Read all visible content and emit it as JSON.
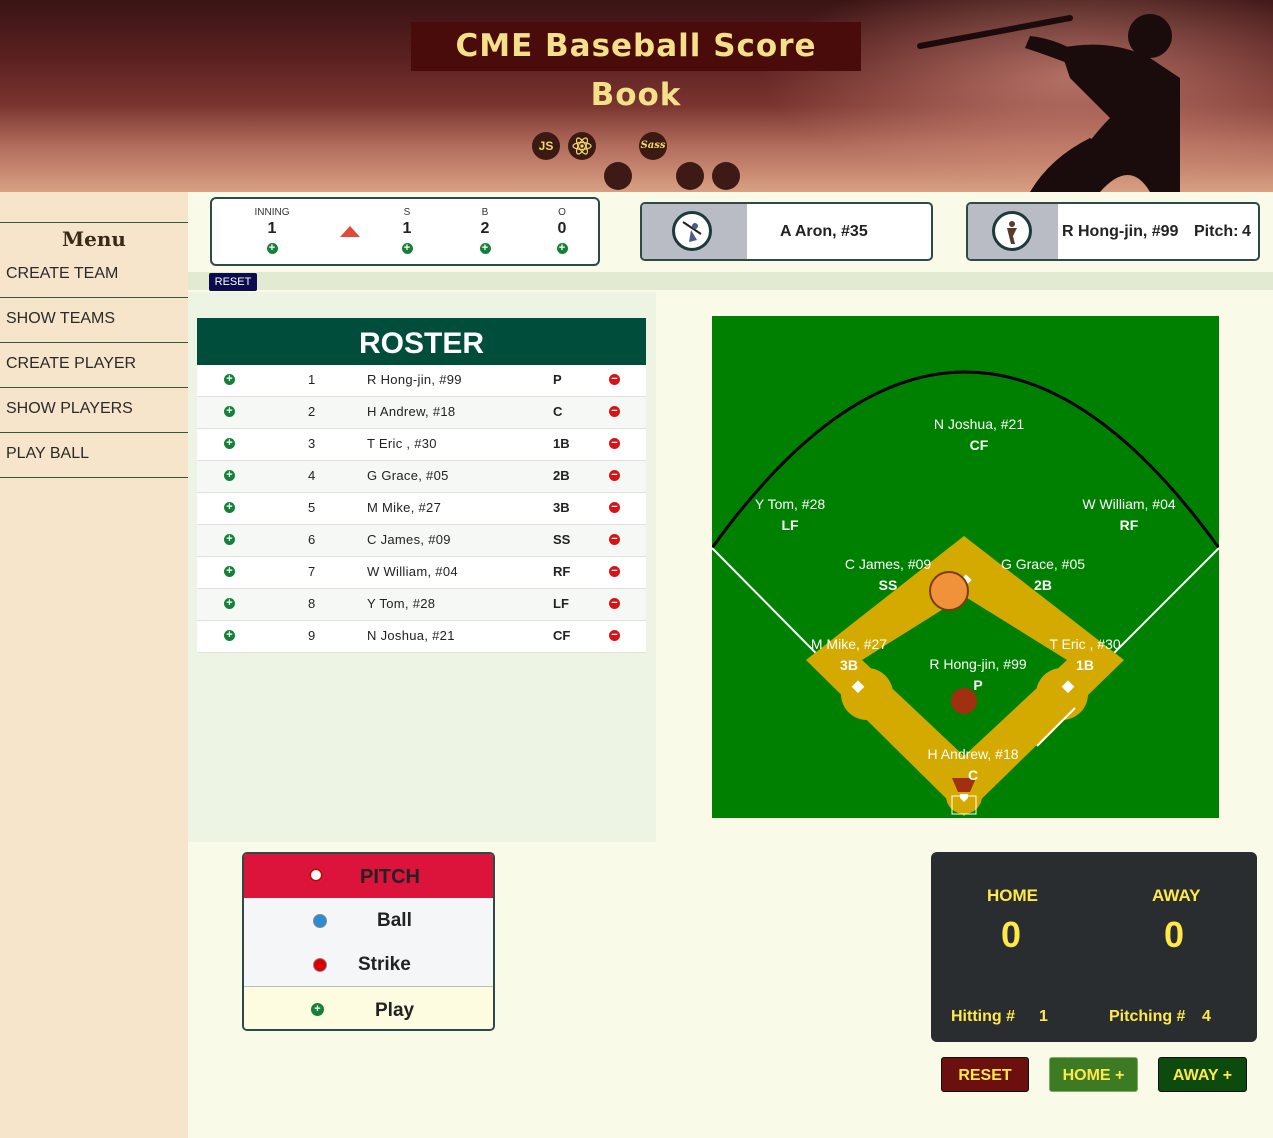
{
  "header": {
    "title": "CME Baseball Score Book",
    "tech_icons": [
      "javascript-icon",
      "react-icon",
      "sass-icon"
    ],
    "tech_labels": {
      "js": "JS",
      "sass": "Sass"
    }
  },
  "sidebar": {
    "title": "Menu",
    "items": [
      {
        "label": "CREATE TEAM"
      },
      {
        "label": "SHOW TEAMS"
      },
      {
        "label": "CREATE PLAYER"
      },
      {
        "label": "SHOW PLAYERS"
      },
      {
        "label": "PLAY BALL"
      }
    ]
  },
  "count": {
    "inning_label": "INNING",
    "inning": "1",
    "half": "top",
    "strikes_label": "S",
    "strikes": "1",
    "balls_label": "B",
    "balls": "2",
    "outs_label": "O",
    "outs": "0",
    "reset_label": "RESET"
  },
  "batter": {
    "name": "A Aron, #35"
  },
  "pitcher": {
    "name": "R Hong-jin, #99",
    "pitch_label": "Pitch:",
    "pitch_count": "4"
  },
  "roster": {
    "title": "ROSTER",
    "rows": [
      {
        "order": "1",
        "name": "R Hong-jin, #99",
        "pos": "P"
      },
      {
        "order": "2",
        "name": "H Andrew, #18",
        "pos": "C"
      },
      {
        "order": "3",
        "name": "T Eric , #30",
        "pos": "1B"
      },
      {
        "order": "4",
        "name": "G Grace, #05",
        "pos": "2B"
      },
      {
        "order": "5",
        "name": "M Mike, #27",
        "pos": "3B"
      },
      {
        "order": "6",
        "name": "C James, #09",
        "pos": "SS"
      },
      {
        "order": "7",
        "name": "W William, #04",
        "pos": "RF"
      },
      {
        "order": "8",
        "name": "Y Tom, #28",
        "pos": "LF"
      },
      {
        "order": "9",
        "name": "N Joshua, #21",
        "pos": "CF"
      }
    ]
  },
  "field": {
    "players": [
      {
        "name": "N Joshua, #21",
        "pos": "CF"
      },
      {
        "name": "Y Tom, #28",
        "pos": "LF"
      },
      {
        "name": "W William, #04",
        "pos": "RF"
      },
      {
        "name": "C James, #09",
        "pos": "SS"
      },
      {
        "name": "G Grace, #05",
        "pos": "2B"
      },
      {
        "name": "M Mike, #27",
        "pos": "3B"
      },
      {
        "name": "T Eric , #30",
        "pos": "1B"
      },
      {
        "name": "R Hong-jin, #99",
        "pos": "P"
      },
      {
        "name": "H Andrew, #18",
        "pos": "C"
      }
    ],
    "colors": {
      "grass": "#008000",
      "infield": "#d4aa00",
      "mound": "#a0300f",
      "runner": "#f0923a"
    }
  },
  "pitch_panel": {
    "title": "PITCH",
    "ball_label": "Ball",
    "strike_label": "Strike",
    "play_label": "Play"
  },
  "scoreboard": {
    "home_label": "HOME",
    "home_score": "0",
    "away_label": "AWAY",
    "away_score": "0",
    "hitting_label": "Hitting #",
    "hitting_value": "1",
    "pitching_label": "Pitching #",
    "pitching_value": "4"
  },
  "buttons": {
    "reset": "RESET",
    "home": "HOME +",
    "away": "AWAY +"
  },
  "colors": {
    "accent": "#004d3c",
    "pitch_header": "#dc143c",
    "scoreboard_text": "#ffe94a"
  }
}
